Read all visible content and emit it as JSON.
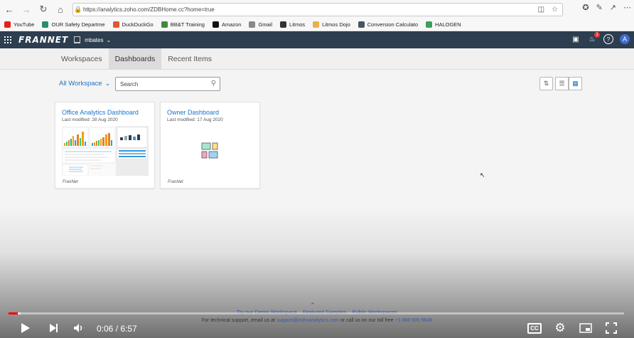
{
  "browser": {
    "url": "https://analytics.zoho.com/ZDBHome.cc?home=true",
    "bookmarks": [
      {
        "label": "YouTube",
        "color": "#e62117"
      },
      {
        "label": "OUR Safety Departme",
        "color": "#2a8c6a"
      },
      {
        "label": "DuckDuckGo",
        "color": "#de5833"
      },
      {
        "label": "BB&T Training",
        "color": "#3c8c3c"
      },
      {
        "label": "Amazon",
        "color": "#111111"
      },
      {
        "label": "Gmail",
        "color": "#888888"
      },
      {
        "label": "Litmos",
        "color": "#333333"
      },
      {
        "label": "Litmos Dojo",
        "color": "#e8b04a"
      },
      {
        "label": "Conversion Calculato",
        "color": "#445566"
      },
      {
        "label": "HALOGEN",
        "color": "#3aa05a"
      }
    ]
  },
  "app": {
    "logo": "FRANNET",
    "user": "mbates",
    "notification_count": "1",
    "avatar_letter": "A",
    "accent_color": "#1a73c8",
    "header_color": "#2c3e50"
  },
  "tabs": [
    {
      "label": "Workspaces"
    },
    {
      "label": "Dashboards"
    },
    {
      "label": "Recent Items"
    }
  ],
  "toolbar": {
    "workspace_select": "All Workspace",
    "search_placeholder": "Search"
  },
  "dashboards": [
    {
      "title": "Office Analytics Dashboard",
      "modified": "Last modified: 28 Aug 2020",
      "workspace": "FranNet"
    },
    {
      "title": "Owner Dashboard",
      "modified": "Last modified: 17 Aug 2020",
      "workspace": "FranNet"
    }
  ],
  "footer": {
    "links": [
      "Try our Demo Workspace",
      "Featured Samples",
      "Public Workspaces"
    ],
    "support_prefix": "For technical support, email us at",
    "support_email": "support@zohoanalytics.com",
    "support_middle": "or call us on our toll free",
    "support_phone": "+1 888 900 9646"
  },
  "player": {
    "time": "0:06 / 6:57",
    "progress": 0.015
  }
}
